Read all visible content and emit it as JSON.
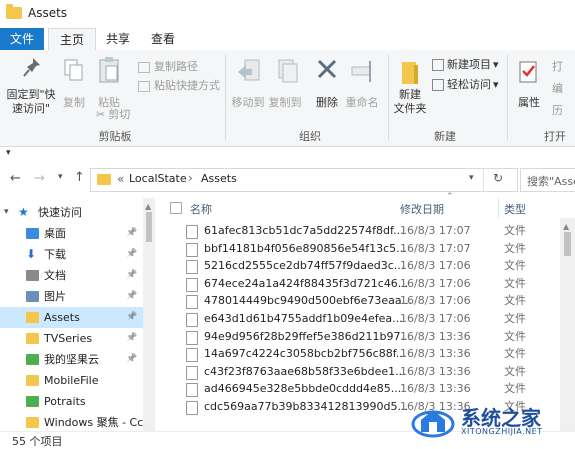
{
  "window": {
    "title": "Assets"
  },
  "tabs": {
    "file": "文件",
    "home": "主页",
    "share": "共享",
    "view": "查看"
  },
  "ribbon": {
    "clipboard": {
      "pin_label": "固定到\"快\n速访问\"",
      "copy_label": "复制",
      "paste_label": "粘贴",
      "copy_path": "复制路径",
      "paste_shortcut": "粘贴快捷方式",
      "cut": "剪切",
      "group": "剪贴板"
    },
    "organize": {
      "move_to": "移动到",
      "copy_to": "复制到",
      "delete": "删除",
      "rename": "重命名",
      "group": "组织"
    },
    "new": {
      "new_folder": "新建\n文件夹",
      "new_item": "新建项目",
      "easy_access": "轻松访问",
      "group": "新建"
    },
    "open": {
      "properties": "属性",
      "open1": "打",
      "open2": "编",
      "open3": "历",
      "group": "打开"
    }
  },
  "address": {
    "chevrons": "«",
    "path1": "LocalState",
    "sep": "›",
    "path2": "Assets",
    "search_placeholder": "搜索\"Asse"
  },
  "nav": {
    "items": [
      {
        "label": "快速访问",
        "icon": "star-icon",
        "pin": false
      },
      {
        "label": "桌面",
        "icon": "desktop-icon",
        "pin": true
      },
      {
        "label": "下载",
        "icon": "download-icon",
        "pin": true
      },
      {
        "label": "文档",
        "icon": "document-icon",
        "pin": true
      },
      {
        "label": "图片",
        "icon": "pictures-icon",
        "pin": true
      },
      {
        "label": "Assets",
        "icon": "folder-icon",
        "pin": true
      },
      {
        "label": "TVSeries",
        "icon": "folder-icon",
        "pin": true
      },
      {
        "label": "我的坚果云",
        "icon": "cloud-folder-icon",
        "pin": true
      },
      {
        "label": "MobileFile",
        "icon": "folder-icon",
        "pin": false
      },
      {
        "label": "Potraits",
        "icon": "cloud-folder-icon",
        "pin": false
      },
      {
        "label": "Windows 聚焦 - Cc",
        "icon": "folder-icon",
        "pin": false
      }
    ]
  },
  "list": {
    "headers": {
      "name": "名称",
      "date": "修改日期",
      "type": "类型"
    },
    "rows": [
      {
        "name": "61afec813cb51dc7a5dd22574f8df...",
        "date": "16/8/3 17:07",
        "type": "文件"
      },
      {
        "name": "bbf14181b4f056e890856e54f13c5...",
        "date": "16/8/3 17:07",
        "type": "文件"
      },
      {
        "name": "5216cd2555ce2db74ff57f9daed3c...",
        "date": "16/8/3 17:06",
        "type": "文件"
      },
      {
        "name": "674ece24a1a424f88435f3d721c46...",
        "date": "16/8/3 17:06",
        "type": "文件"
      },
      {
        "name": "478014449bc9490d500ebf6e73eaa...",
        "date": "16/8/3 17:06",
        "type": "文件"
      },
      {
        "name": "e643d1d61b4755addf1b09e4efea...",
        "date": "16/8/3 17:06",
        "type": "文件"
      },
      {
        "name": "94e9d956f28b29ffef5e386d211b97...",
        "date": "16/8/3 13:36",
        "type": "文件"
      },
      {
        "name": "14a697c4224c3058bcb2bf756c88f...",
        "date": "16/8/3 13:36",
        "type": "文件"
      },
      {
        "name": "c43f23f8763aae68b58f33e6bdee1...",
        "date": "16/8/3 13:36",
        "type": "文件"
      },
      {
        "name": "ad466945e328e5bbde0cddd4e85...",
        "date": "16/8/3 13:36",
        "type": "文件"
      },
      {
        "name": "cdc569aa77b39b833412813990d5...",
        "date": "16/8/3 13:36",
        "type": "文件"
      }
    ]
  },
  "status": {
    "count": "55 个项目"
  },
  "watermark": {
    "brand": "系统之家",
    "url": "XITONGZHIJIA.NET"
  },
  "colors": {
    "accent": "#1979ca",
    "selected": "#cce8ff",
    "folder": "#f3c74d"
  }
}
